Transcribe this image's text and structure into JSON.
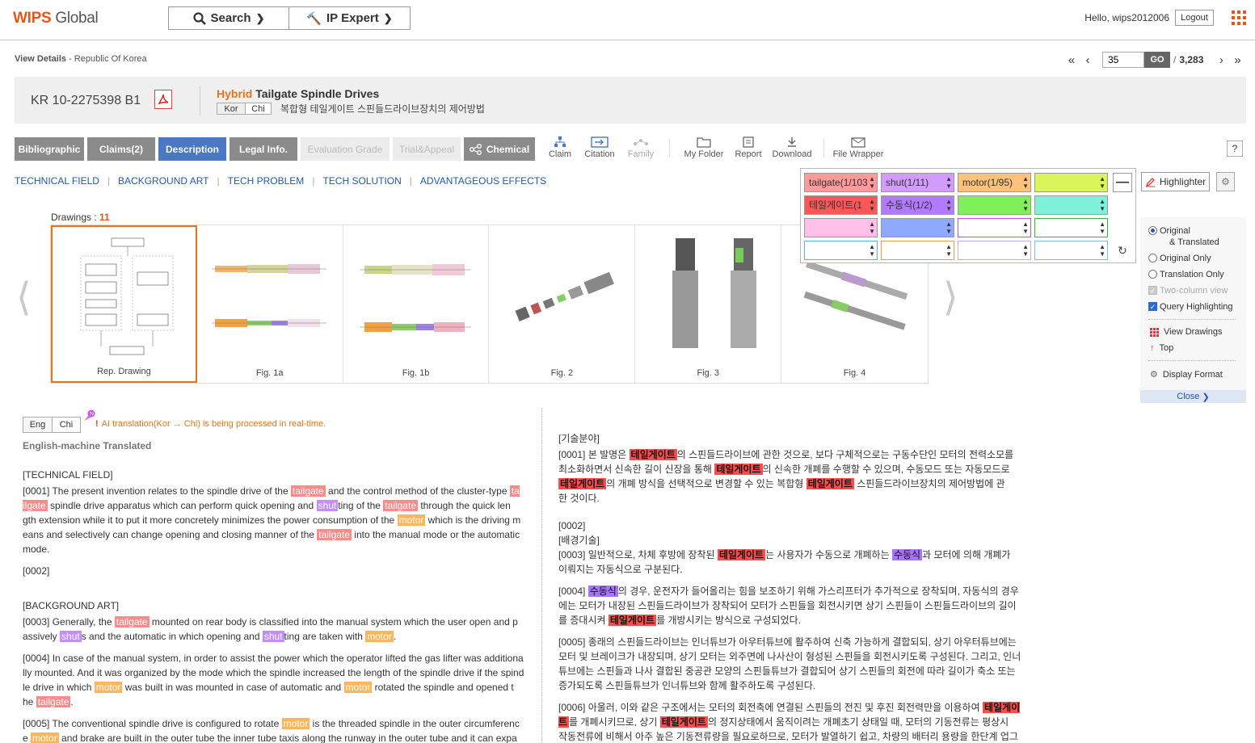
{
  "brand": {
    "logo_w": "WIPS",
    "logo_rest": " Global"
  },
  "topnav": {
    "search_label": "Search",
    "expert_label": "IP Expert"
  },
  "user": {
    "hello": "Hello, wips2012006",
    "logout": "Logout"
  },
  "breadcrumb": {
    "first": "View Details",
    "rest": " - Republic Of Korea"
  },
  "pager": {
    "current": "35",
    "go": "GO",
    "separator": "/",
    "total": "3,283"
  },
  "patent": {
    "number": "KR 10-2275398 B1",
    "title_highlight": "Hybrid",
    "title_rest": " Tailgate Spindle Drives",
    "lang_tabs": [
      "Kor",
      "Chi"
    ],
    "korean_title": "복합형 테일게이트 스핀들드라이브장치의 제어방법"
  },
  "tabs": [
    {
      "label": "Bibliographic",
      "state": "normal"
    },
    {
      "label": "Claims(2)",
      "state": "normal"
    },
    {
      "label": "Description",
      "state": "active"
    },
    {
      "label": "Legal Info.",
      "state": "normal"
    },
    {
      "label": "Evaluation Grade",
      "state": "disabled"
    },
    {
      "label": "Trial&Appeal",
      "state": "disabled"
    },
    {
      "label": "Chemical",
      "state": "normal"
    }
  ],
  "tools": [
    {
      "label": "Claim",
      "icon": "claim-tree-icon"
    },
    {
      "label": "Citation",
      "icon": "citation-icon"
    },
    {
      "label": "Family",
      "icon": "family-icon"
    },
    {
      "label": "My Folder",
      "icon": "folder-icon"
    },
    {
      "label": "Report",
      "icon": "report-icon"
    },
    {
      "label": "Download",
      "icon": "download-icon"
    },
    {
      "label": "File Wrapper",
      "icon": "file-wrapper-icon"
    }
  ],
  "help": "?",
  "sections": [
    "TECHNICAL FIELD",
    "BACKGROUND ART",
    "TECH PROBLEM",
    "TECH SOLUTION",
    "ADVANTAGEOUS EFFECTS"
  ],
  "drawings": {
    "label": "Drawings : ",
    "count": "11",
    "items": [
      "Rep. Drawing",
      "Fig. 1a",
      "Fig. 1b",
      "Fig. 2",
      "Fig. 3",
      "Fig. 4"
    ]
  },
  "highlighter": {
    "terms": [
      {
        "text": "tailgate(1/103",
        "color": "#ff9a9a"
      },
      {
        "text": "shut(1/11)",
        "color": "#d29cff"
      },
      {
        "text": "motor(1/95)",
        "color": "#ffc27a"
      },
      {
        "text": "",
        "color": "#d9f55a"
      },
      {
        "text": "테일게이트(1",
        "color": "#ff5757"
      },
      {
        "text": "수동식(1/2)",
        "color": "#b27aff"
      },
      {
        "text": "",
        "color": "#7ff05a"
      },
      {
        "text": "",
        "color": "#7ff0d9"
      },
      {
        "text": "",
        "color": "#ffbfe9"
      },
      {
        "text": "",
        "color": "#8fa9ff"
      },
      {
        "text": "",
        "color": "#ffffff"
      },
      {
        "text": "",
        "color": "#ffffff"
      },
      {
        "text": "",
        "color": "#ffffff"
      },
      {
        "text": "",
        "color": "#ffffff"
      },
      {
        "text": "",
        "color": "#ffffff"
      },
      {
        "text": "",
        "color": "#ffffff"
      }
    ],
    "button": "Highlighter"
  },
  "view_options": {
    "original_translated_1": "Original",
    "original_translated_2": "& Translated",
    "original_only": "Original Only",
    "translation_only": "Translation Only",
    "two_column": "Two-column view",
    "query_highlighting": "Query Highlighting",
    "view_drawings": "View Drawings",
    "top": "Top",
    "display_format": "Display Format",
    "close": "Close"
  },
  "left_doc": {
    "lang_tabs": [
      "Eng",
      "Chi"
    ],
    "ai_bang": "!",
    "ai_note": "AI translation(Kor → Chi) is being processed in real-time.",
    "machine": "English-machine Translated"
  },
  "colors": {
    "accent": "#e8541a",
    "active_tab": "#4a78c2",
    "link": "#1f5aa6"
  }
}
